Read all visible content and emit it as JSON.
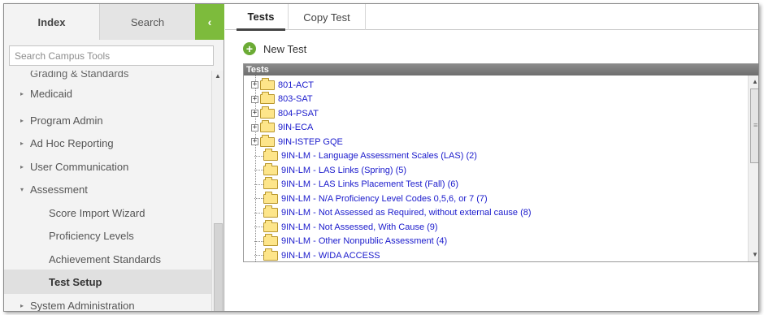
{
  "sidebar": {
    "tabs": {
      "index": "Index",
      "search": "Search"
    },
    "collapse_glyph": "‹",
    "search_placeholder": "Search Campus Tools",
    "clipped_item": "Grading & Standards",
    "items": [
      {
        "label": "Medicaid",
        "arrow": "▸"
      },
      {
        "label": "Program Admin",
        "arrow": "▸"
      },
      {
        "label": "Ad Hoc Reporting",
        "arrow": "▸"
      },
      {
        "label": "User Communication",
        "arrow": "▸"
      },
      {
        "label": "Assessment",
        "arrow": "▾"
      },
      {
        "label": "Score Import Wizard"
      },
      {
        "label": "Proficiency Levels"
      },
      {
        "label": "Achievement Standards"
      },
      {
        "label": "Test Setup"
      },
      {
        "label": "System Administration",
        "arrow": "▸"
      }
    ]
  },
  "main": {
    "tabs": {
      "tests": "Tests",
      "copy_test": "Copy Test"
    },
    "new_test_label": "New Test",
    "panel_title": "Tests",
    "tree": [
      {
        "label": "801-ACT",
        "expandable": true
      },
      {
        "label": "803-SAT",
        "expandable": true
      },
      {
        "label": "804-PSAT",
        "expandable": true
      },
      {
        "label": "9IN-ECA",
        "expandable": true
      },
      {
        "label": "9IN-ISTEP GQE",
        "expandable": true
      },
      {
        "label": "9IN-LM - Language Assessment Scales (LAS) (2)",
        "expandable": false
      },
      {
        "label": "9IN-LM - LAS Links (Spring) (5)",
        "expandable": false
      },
      {
        "label": "9IN-LM - LAS Links Placement Test (Fall) (6)",
        "expandable": false
      },
      {
        "label": "9IN-LM - N/A Proficiency Level Codes 0,5,6, or 7 (7)",
        "expandable": false
      },
      {
        "label": "9IN-LM - Not Assessed as Required, without external cause (8)",
        "expandable": false
      },
      {
        "label": "9IN-LM - Not Assessed, With Cause (9)",
        "expandable": false
      },
      {
        "label": "9IN-LM - Other Nonpublic Assessment (4)",
        "expandable": false
      },
      {
        "label": "9IN-LM - WIDA ACCESS",
        "expandable": false
      }
    ]
  },
  "colors": {
    "accent_green": "#7dbb3c",
    "link_blue": "#1a1acc",
    "folder_yellow": "#fde58a"
  }
}
